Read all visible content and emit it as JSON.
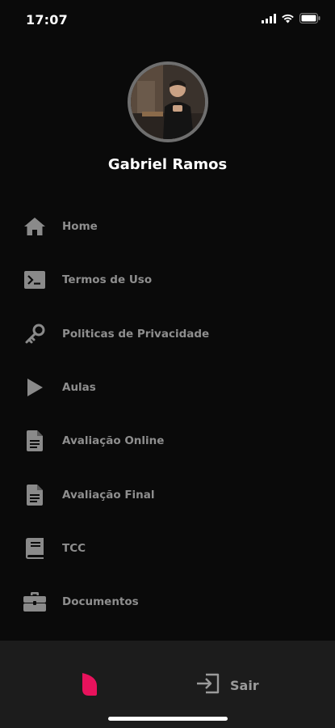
{
  "status_bar": {
    "time": "17:07",
    "icons": [
      "cellular-signal-icon",
      "wifi-icon",
      "battery-icon"
    ]
  },
  "profile": {
    "name": "Gabriel Ramos"
  },
  "menu": {
    "items": [
      {
        "label": "Home",
        "icon": "home-icon"
      },
      {
        "label": "Termos de Uso",
        "icon": "terminal-icon"
      },
      {
        "label": "Politicas de Privacidade",
        "icon": "key-icon"
      },
      {
        "label": "Aulas",
        "icon": "play-icon"
      },
      {
        "label": "Avaliação Online",
        "icon": "document-icon"
      },
      {
        "label": "Avaliação Final",
        "icon": "document-icon"
      },
      {
        "label": "TCC",
        "icon": "book-icon"
      },
      {
        "label": "Documentos",
        "icon": "briefcase-icon"
      }
    ]
  },
  "bottom_bar": {
    "logo_icon": "brand-logo-icon",
    "logout_label": "Sair",
    "logout_icon": "sign-out-icon"
  },
  "colors": {
    "background": "#0a0a0a",
    "bottom_bar": "#1c1c1c",
    "menu_text": "#8e8e8e",
    "menu_icon": "#8a8a8a",
    "brand_accent": "#e8125c"
  }
}
